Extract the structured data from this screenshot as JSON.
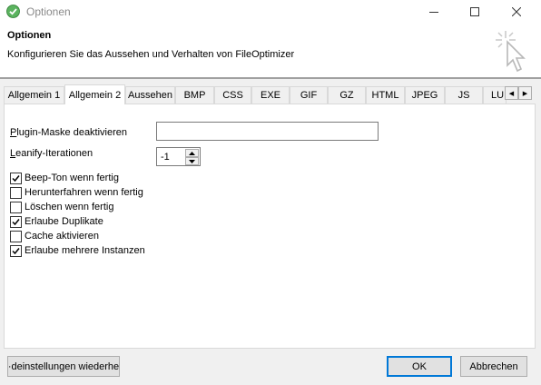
{
  "window": {
    "title": "Optionen",
    "icon": "fileoptimizer-app-icon",
    "controls": [
      "minimize-icon",
      "maximize-icon",
      "close-icon"
    ]
  },
  "header": {
    "title": "Optionen",
    "subtitle": "Konfigurieren Sie das Aussehen und Verhalten von FileOptimizer",
    "icon": "magic-wand-cursor-icon"
  },
  "tabs": [
    {
      "label": "Allgemein 1",
      "active": false
    },
    {
      "label": "Allgemein 2",
      "active": true
    },
    {
      "label": "Aussehen",
      "active": false
    },
    {
      "label": "BMP",
      "active": false
    },
    {
      "label": "CSS",
      "active": false
    },
    {
      "label": "EXE",
      "active": false
    },
    {
      "label": "GIF",
      "active": false
    },
    {
      "label": "GZ",
      "active": false
    },
    {
      "label": "HTML",
      "active": false
    },
    {
      "label": "JPEG",
      "active": false
    },
    {
      "label": "JS",
      "active": false
    },
    {
      "label": "LU",
      "active": false
    }
  ],
  "fields": {
    "plugin_mask_label": "Plugin-Maske deaktivieren",
    "plugin_mask_value": "",
    "leanify_label": "Leanify-Iterationen",
    "leanify_value": "-1"
  },
  "checkboxes": [
    {
      "label": "Beep-Ton wenn fertig",
      "checked": true
    },
    {
      "label": "Herunterfahren wenn fertig",
      "checked": false
    },
    {
      "label": "Löschen wenn fertig",
      "checked": false
    },
    {
      "label": "Erlaube Duplikate",
      "checked": true
    },
    {
      "label": "Cache aktivieren",
      "checked": false
    },
    {
      "label": "Erlaube mehrere Instanzen",
      "checked": true
    }
  ],
  "buttons": {
    "restore_defaults": "·deinstellungen wiederhe",
    "ok": "OK",
    "cancel": "Abbrechen"
  },
  "colors": {
    "accent": "#0078d7",
    "app_icon": "#4caf50"
  }
}
